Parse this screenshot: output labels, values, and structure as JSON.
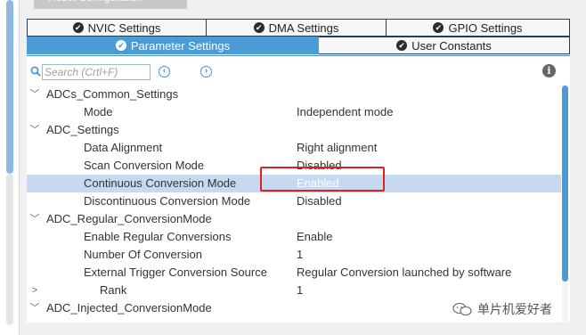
{
  "toolbar_top": {
    "reset_label": "Reset Configuration"
  },
  "tabs_row1": [
    {
      "label": "NVIC Settings",
      "active": false
    },
    {
      "label": "DMA Settings",
      "active": false
    },
    {
      "label": "GPIO Settings",
      "active": false
    }
  ],
  "tabs_row2": [
    {
      "label": "Parameter Settings",
      "active": true
    },
    {
      "label": "User Constants",
      "active": false
    }
  ],
  "search": {
    "placeholder": "Search (Crtl+F)"
  },
  "tree": {
    "groups": [
      {
        "label": "ADCs_Common_Settings",
        "toggle": "﹀"
      },
      {
        "label": "ADC_Settings",
        "toggle": "﹀"
      },
      {
        "label": "ADC_Regular_ConversionMode",
        "toggle": "﹀"
      },
      {
        "label": "ADC_Injected_ConversionMode",
        "toggle": "﹀"
      }
    ],
    "params": [
      {
        "label": "Mode",
        "value": "Independent mode"
      },
      {
        "label": "Data Alignment",
        "value": "Right alignment"
      },
      {
        "label": "Scan Conversion Mode",
        "value": "Disabled"
      },
      {
        "label": "Continuous Conversion Mode",
        "value": "Enabled"
      },
      {
        "label": "Discontinuous Conversion Mode",
        "value": "Disabled"
      },
      {
        "label": "Enable Regular Conversions",
        "value": "Enable"
      },
      {
        "label": "Number Of Conversion",
        "value": "1"
      },
      {
        "label": "External Trigger Conversion Source",
        "value": "Regular Conversion launched by software"
      },
      {
        "label": "Rank",
        "value": "1",
        "toggle": ">"
      }
    ]
  },
  "watermark": {
    "text": "单片机爱好者"
  },
  "colors": {
    "accent": "#4a9bd6",
    "selected_row": "#c7d9ee",
    "highlight": "#e02020"
  }
}
